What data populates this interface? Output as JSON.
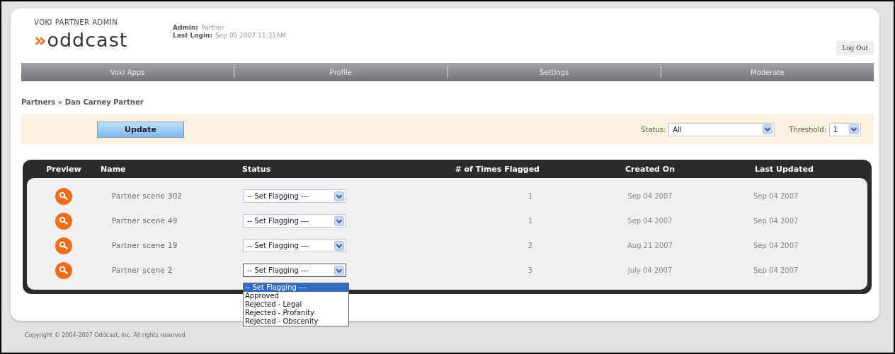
{
  "header": {
    "subtitle": "VOKI PARTNER ADMIN",
    "logo": {
      "mark": "»",
      "name": "oddcast"
    },
    "admin": {
      "label": "Admin:",
      "value": "Partner"
    },
    "last_login": {
      "label": "Last Login:",
      "value": "Sep 05 2007 11:31AM"
    },
    "logout": "Log Out"
  },
  "nav": [
    "Voki Apps",
    "Profile",
    "Settings",
    "Moderate"
  ],
  "breadcrumb": "Partners » Dan Carney Partner",
  "filters": {
    "update": "Update",
    "status": {
      "label": "Status:",
      "value": "All"
    },
    "threshold": {
      "label": "Threshold:",
      "value": "1"
    }
  },
  "table": {
    "columns": [
      "Preview",
      "Name",
      "Status",
      "# of Times Flagged",
      "Created On",
      "Last Updated"
    ],
    "rows": [
      {
        "name": "Partner scene 302",
        "status": "-- Set Flagging ---",
        "flagged": "1",
        "created": "Sep 04 2007",
        "updated": "Sep 04 2007",
        "expanded": false
      },
      {
        "name": "Partner scene 49",
        "status": "-- Set Flagging ---",
        "flagged": "1",
        "created": "Sep 04 2007",
        "updated": "Sep 04 2007",
        "expanded": false
      },
      {
        "name": "Partner scene 19",
        "status": "-- Set Flagging ---",
        "flagged": "2",
        "created": "Aug 21 2007",
        "updated": "Sep 04 2007",
        "expanded": false
      },
      {
        "name": "Partner scene 2",
        "status": "-- Set Flagging ---",
        "flagged": "3",
        "created": "July 04 2007",
        "updated": "Sep 04 2007",
        "expanded": true,
        "options": [
          {
            "label": "-- Set Flagging ---",
            "selected": true
          },
          {
            "label": "Approved",
            "selected": false
          },
          {
            "label": "Rejected - Legal",
            "selected": false
          },
          {
            "label": "Rejected - Profanity",
            "selected": false
          },
          {
            "label": "Rejected - Obscenity",
            "selected": false
          }
        ]
      }
    ]
  },
  "footer": "Copyright © 2004-2007 Oddcast, Inc. All rights reserved."
}
